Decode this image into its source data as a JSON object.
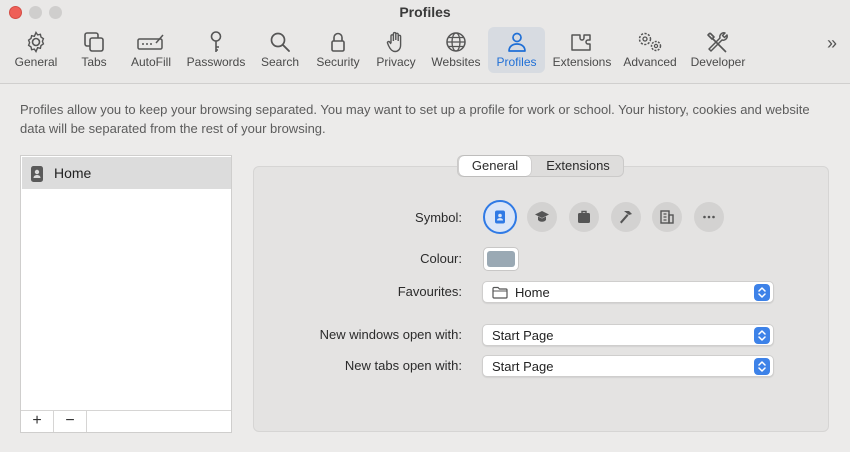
{
  "window": {
    "title": "Profiles"
  },
  "toolbar": {
    "tabs": [
      {
        "label": "General",
        "icon": "gear-icon"
      },
      {
        "label": "Tabs",
        "icon": "tabs-icon"
      },
      {
        "label": "AutoFill",
        "icon": "autofill-icon"
      },
      {
        "label": "Passwords",
        "icon": "key-icon"
      },
      {
        "label": "Search",
        "icon": "magnifier-icon"
      },
      {
        "label": "Security",
        "icon": "lock-icon"
      },
      {
        "label": "Privacy",
        "icon": "hand-icon"
      },
      {
        "label": "Websites",
        "icon": "globe-icon"
      },
      {
        "label": "Profiles",
        "icon": "person-icon",
        "active": true
      },
      {
        "label": "Extensions",
        "icon": "puzzle-icon"
      },
      {
        "label": "Advanced",
        "icon": "gears-icon"
      },
      {
        "label": "Developer",
        "icon": "tools-icon"
      }
    ],
    "more": "»"
  },
  "description": "Profiles allow you to keep your browsing separated. You may want to set up a profile for work or school. Your history, cookies and website data will be separated from the rest of your browsing.",
  "profiles": {
    "items": [
      {
        "label": "Home",
        "icon": "profile-badge-icon",
        "selected": true
      }
    ],
    "add_label": "+",
    "remove_label": "−"
  },
  "settings": {
    "segments": [
      {
        "label": "General",
        "selected": true
      },
      {
        "label": "Extensions",
        "selected": false
      }
    ],
    "symbol_label": "Symbol:",
    "symbols": [
      "person-badge-icon",
      "graduation-cap-icon",
      "briefcase-icon",
      "hammer-icon",
      "building-icon",
      "more-icon"
    ],
    "colour_label": "Colour:",
    "colour_value": "#9aa9b4",
    "favourites_label": "Favourites:",
    "favourites_value": "Home",
    "new_windows_label": "New windows open with:",
    "new_windows_value": "Start Page",
    "new_tabs_label": "New tabs open with:",
    "new_tabs_value": "Start Page"
  },
  "colors": {
    "accent": "#2f7ae5",
    "close": "#ee5f57"
  }
}
